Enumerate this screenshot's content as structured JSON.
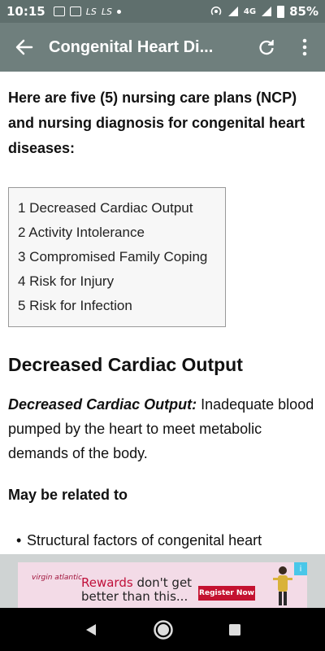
{
  "status_bar": {
    "time": "10:15",
    "network": "4G",
    "battery": "85%",
    "icons": [
      "image-icon",
      "app-icon",
      "ls-icon",
      "ls-icon",
      "dot-icon",
      "hotspot-icon",
      "signal-icon",
      "signal-icon-2",
      "battery-icon"
    ]
  },
  "app_bar": {
    "title": "Congenital Heart Di...",
    "back_icon": "back-arrow-icon",
    "reload_icon": "refresh-icon",
    "more_icon": "more-vert-icon",
    "color": "#6f7f7d"
  },
  "content": {
    "intro": "Here are five (5) nursing care plans (NCP) and nursing diagnosis for congenital heart diseases:",
    "toc": [
      "1 Decreased Cardiac Output",
      "2 Activity Intolerance",
      "3 Compromised Family Coping",
      "4 Risk for Injury",
      "5 Risk for Infection"
    ],
    "section_title": "Decreased Cardiac Output",
    "definition_term": "Decreased Cardiac Output:",
    "definition_text": " Inadequate blood pumped by the heart to meet metabolic demands of the body.",
    "related_heading": "May be related to",
    "bullets": [
      "Structural factors of congenital heart"
    ]
  },
  "ad": {
    "brand": "virgin atlantic",
    "headline_red": "Rewards",
    "headline_rest": " don't get better than this...",
    "cta": "Register Now",
    "info": "i"
  },
  "nav": {
    "back_icon": "nav-back-icon",
    "home_icon": "nav-home-icon",
    "recents_icon": "nav-recents-icon"
  }
}
